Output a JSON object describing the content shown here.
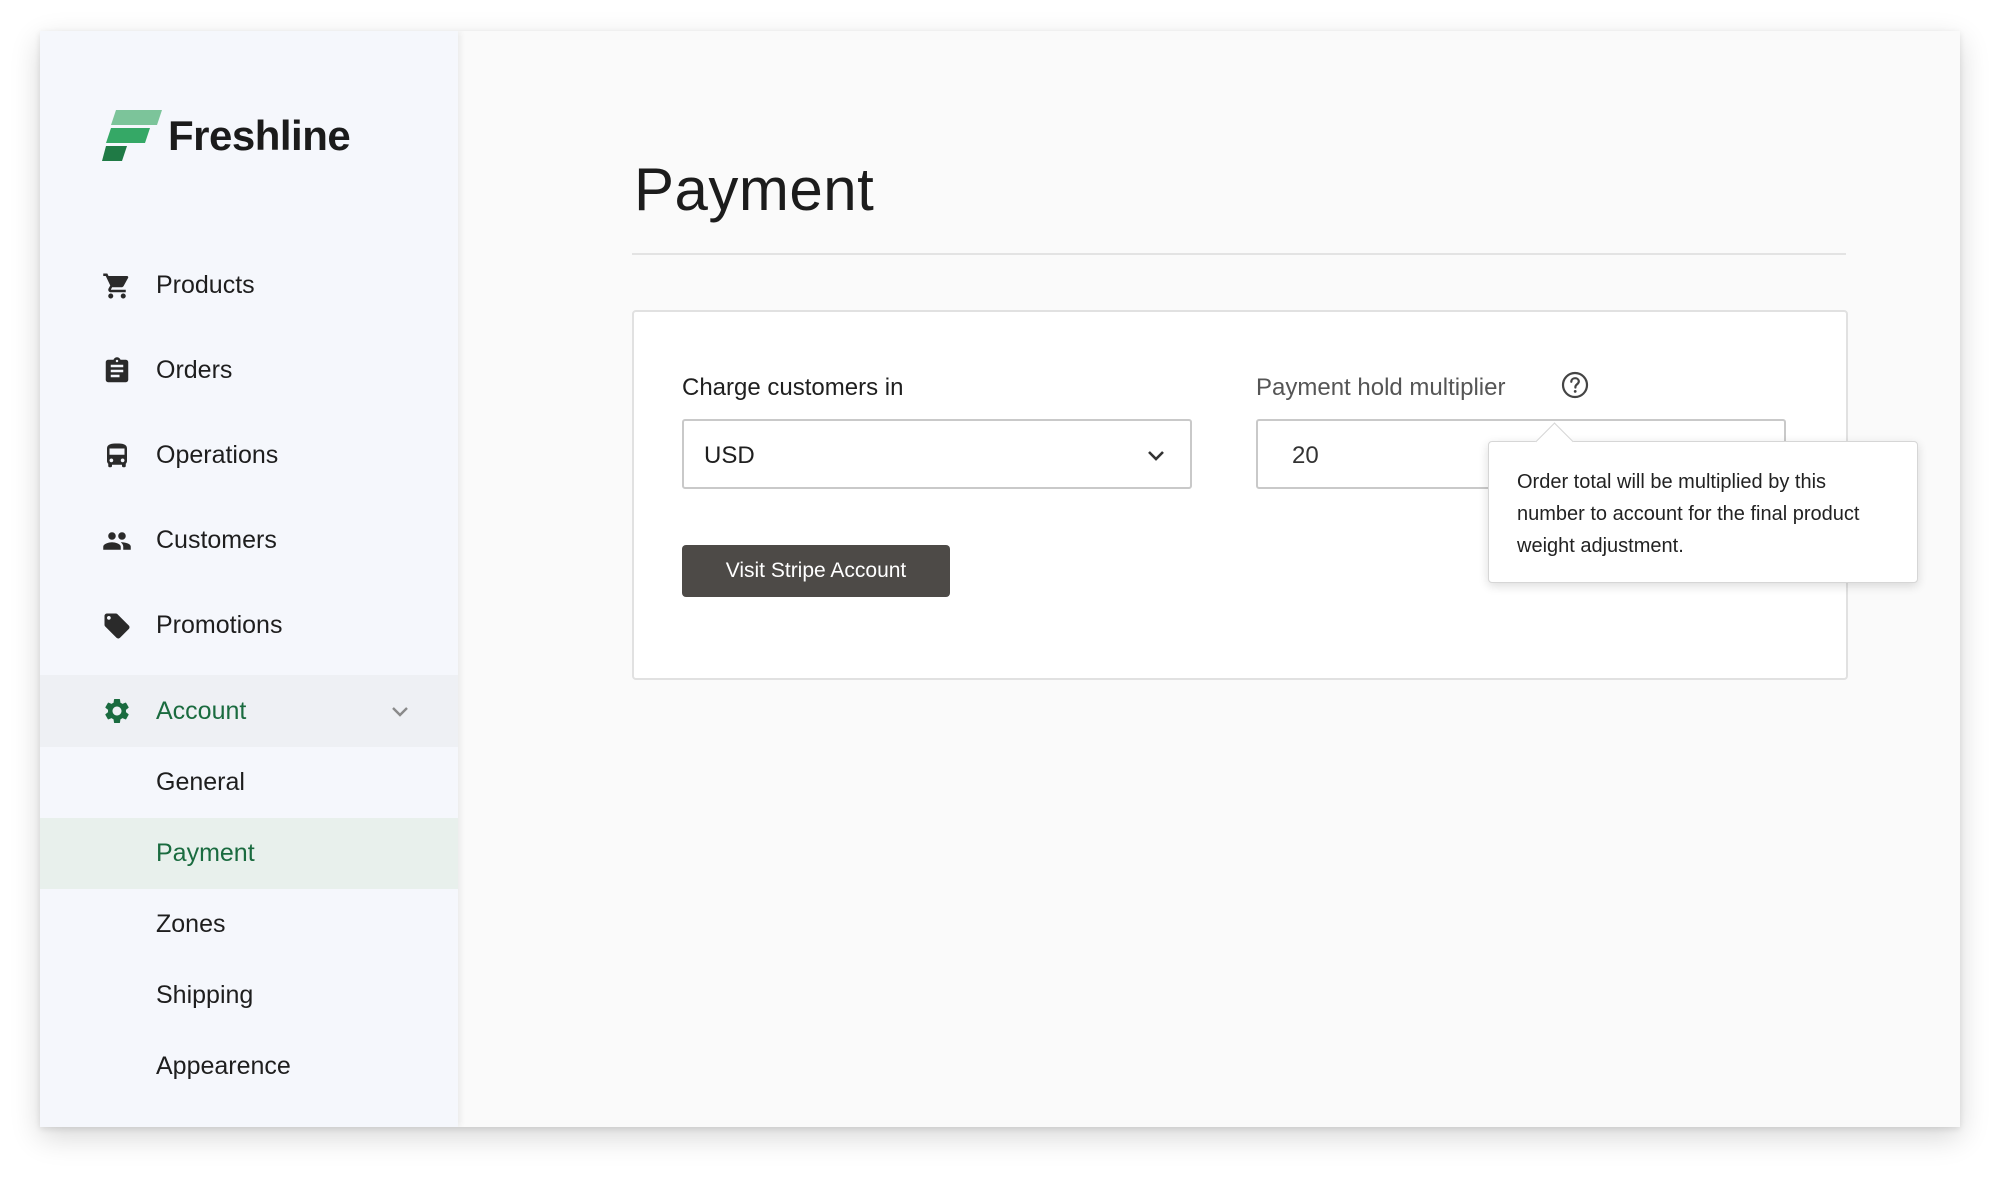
{
  "brand": {
    "name": "Freshline",
    "colors": {
      "primary": "#1a6b3f",
      "logo_light": "#7cc49a",
      "logo_mid": "#35a866",
      "logo_dark": "#1f7a45"
    }
  },
  "sidebar": {
    "items": [
      {
        "label": "Products",
        "icon": "shopping-cart-icon"
      },
      {
        "label": "Orders",
        "icon": "clipboard-icon"
      },
      {
        "label": "Operations",
        "icon": "bus-icon"
      },
      {
        "label": "Customers",
        "icon": "people-icon"
      },
      {
        "label": "Promotions",
        "icon": "tag-icon"
      }
    ],
    "account": {
      "label": "Account",
      "icon": "gear-icon",
      "expanded": true,
      "sub_items": [
        {
          "label": "General"
        },
        {
          "label": "Payment",
          "active": true
        },
        {
          "label": "Zones"
        },
        {
          "label": "Shipping"
        },
        {
          "label": "Appearence"
        }
      ]
    }
  },
  "main": {
    "title": "Payment",
    "currency": {
      "label": "Charge customers in",
      "value": "USD"
    },
    "hold_multiplier": {
      "label": "Payment hold multiplier",
      "value": "20",
      "help_icon": "question-circle-icon"
    },
    "stripe_button_label": "Visit Stripe Account",
    "tooltip": "Order total will be multiplied by this number to account for the final product weight adjustment."
  }
}
